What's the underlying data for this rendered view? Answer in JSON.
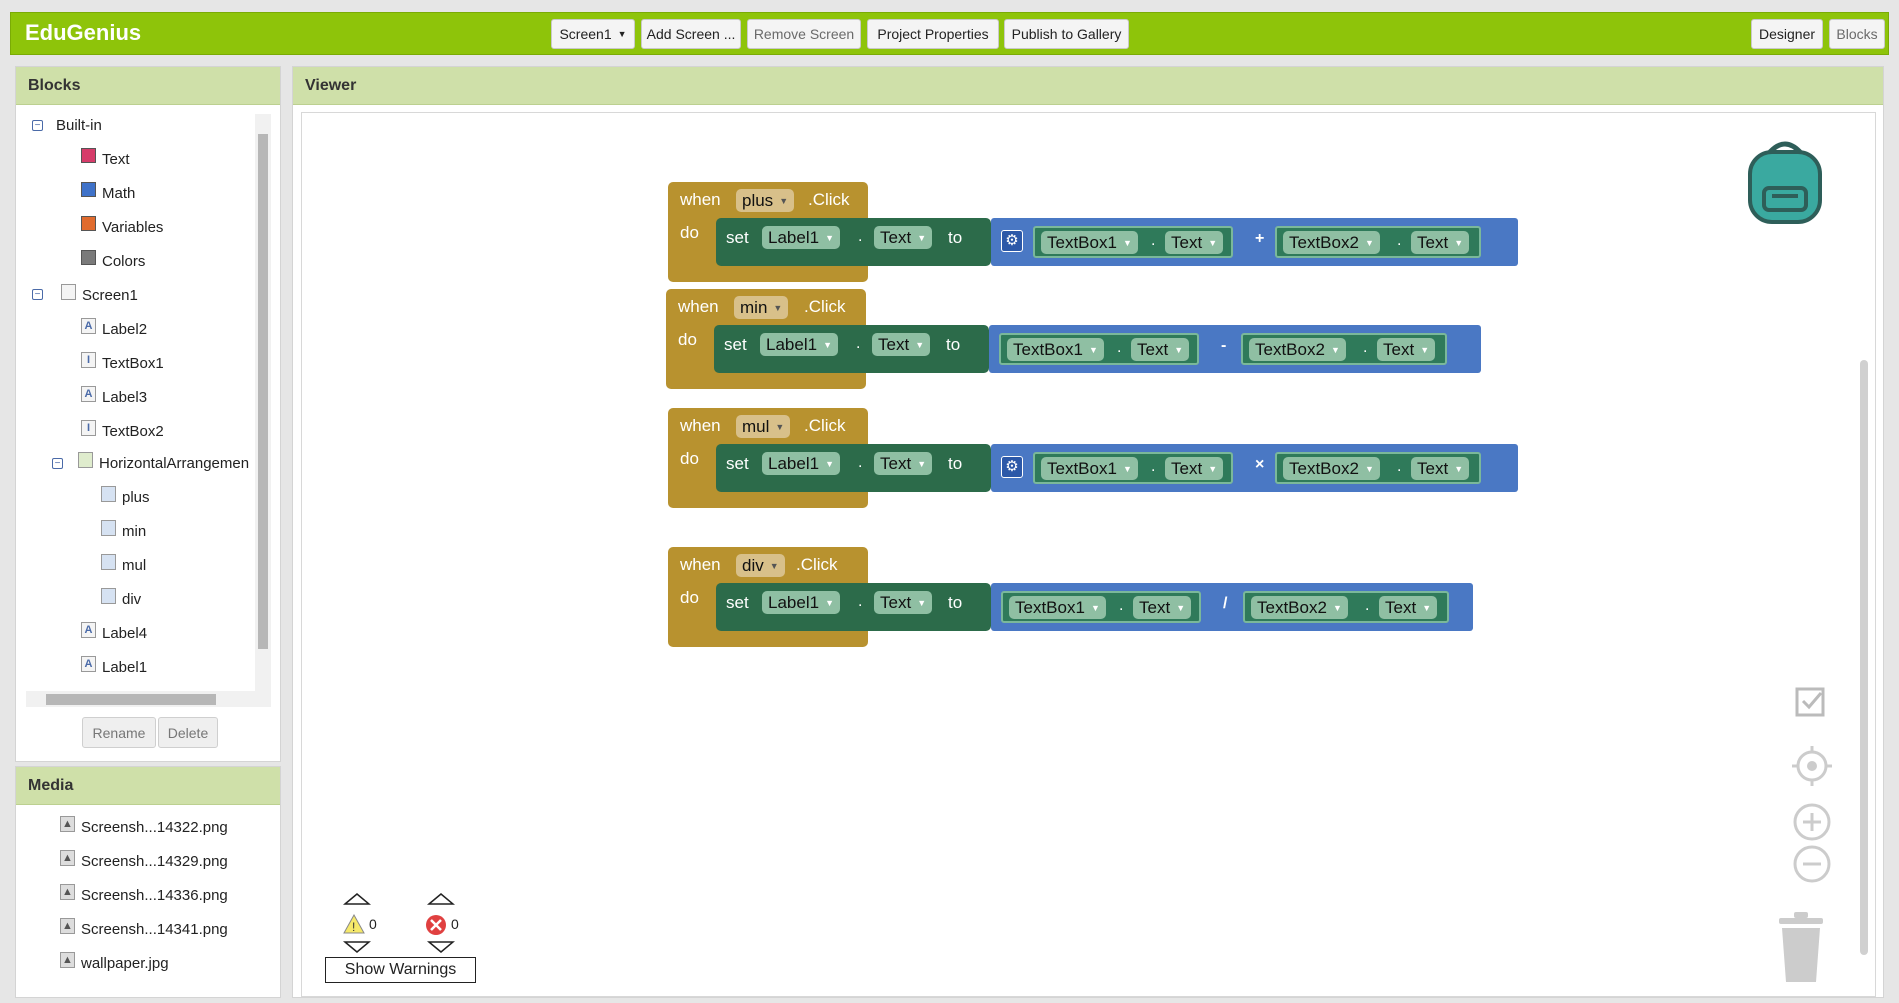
{
  "app": {
    "title": "EduGenius"
  },
  "toolbar": {
    "screen_select": "Screen1",
    "add_screen": "Add Screen ...",
    "remove_screen": "Remove Screen",
    "project_properties": "Project Properties",
    "publish": "Publish to Gallery",
    "designer": "Designer",
    "blocks": "Blocks"
  },
  "blocks_panel": {
    "title": "Blocks",
    "builtin": {
      "label": "Built-in",
      "items": [
        {
          "label": "Text",
          "color": "#d63c6a"
        },
        {
          "label": "Math",
          "color": "#3f72c9"
        },
        {
          "label": "Variables",
          "color": "#e06b2e"
        },
        {
          "label": "Colors",
          "color": "#7a7a7a"
        }
      ]
    },
    "screen": {
      "label": "Screen1",
      "items": [
        "Label2",
        "TextBox1",
        "Label3",
        "TextBox2"
      ]
    },
    "arrangement": {
      "label": "HorizontalArrangemen",
      "items": [
        "plus",
        "min",
        "mul",
        "div"
      ]
    },
    "after": [
      "Label4",
      "Label1"
    ],
    "rename": "Rename",
    "delete": "Delete"
  },
  "media_panel": {
    "title": "Media",
    "files": [
      "Screensh...14322.png",
      "Screensh...14329.png",
      "Screensh...14336.png",
      "Screensh...14341.png",
      "wallpaper.jpg"
    ]
  },
  "viewer": {
    "title": "Viewer"
  },
  "block_words": {
    "when": "when",
    "do": "do",
    "click": ".Click",
    "set": "set",
    "to": "to",
    "dot": "."
  },
  "events": [
    {
      "button": "plus",
      "label": "Label1",
      "prop": "Text",
      "op": "+",
      "left": "TextBox1",
      "left_prop": "Text",
      "right": "TextBox2",
      "right_prop": "Text",
      "gear": true
    },
    {
      "button": "min",
      "label": "Label1",
      "prop": "Text",
      "op": "-",
      "left": "TextBox1",
      "left_prop": "Text",
      "right": "TextBox2",
      "right_prop": "Text",
      "gear": false
    },
    {
      "button": "mul",
      "label": "Label1",
      "prop": "Text",
      "op": "×",
      "left": "TextBox1",
      "left_prop": "Text",
      "right": "TextBox2",
      "right_prop": "Text",
      "gear": true
    },
    {
      "button": "div",
      "label": "Label1",
      "prop": "Text",
      "op": "/",
      "left": "TextBox1",
      "left_prop": "Text",
      "right": "TextBox2",
      "right_prop": "Text",
      "gear": false
    }
  ],
  "warnings": {
    "warning_count": "0",
    "error_count": "0",
    "button": "Show Warnings"
  }
}
